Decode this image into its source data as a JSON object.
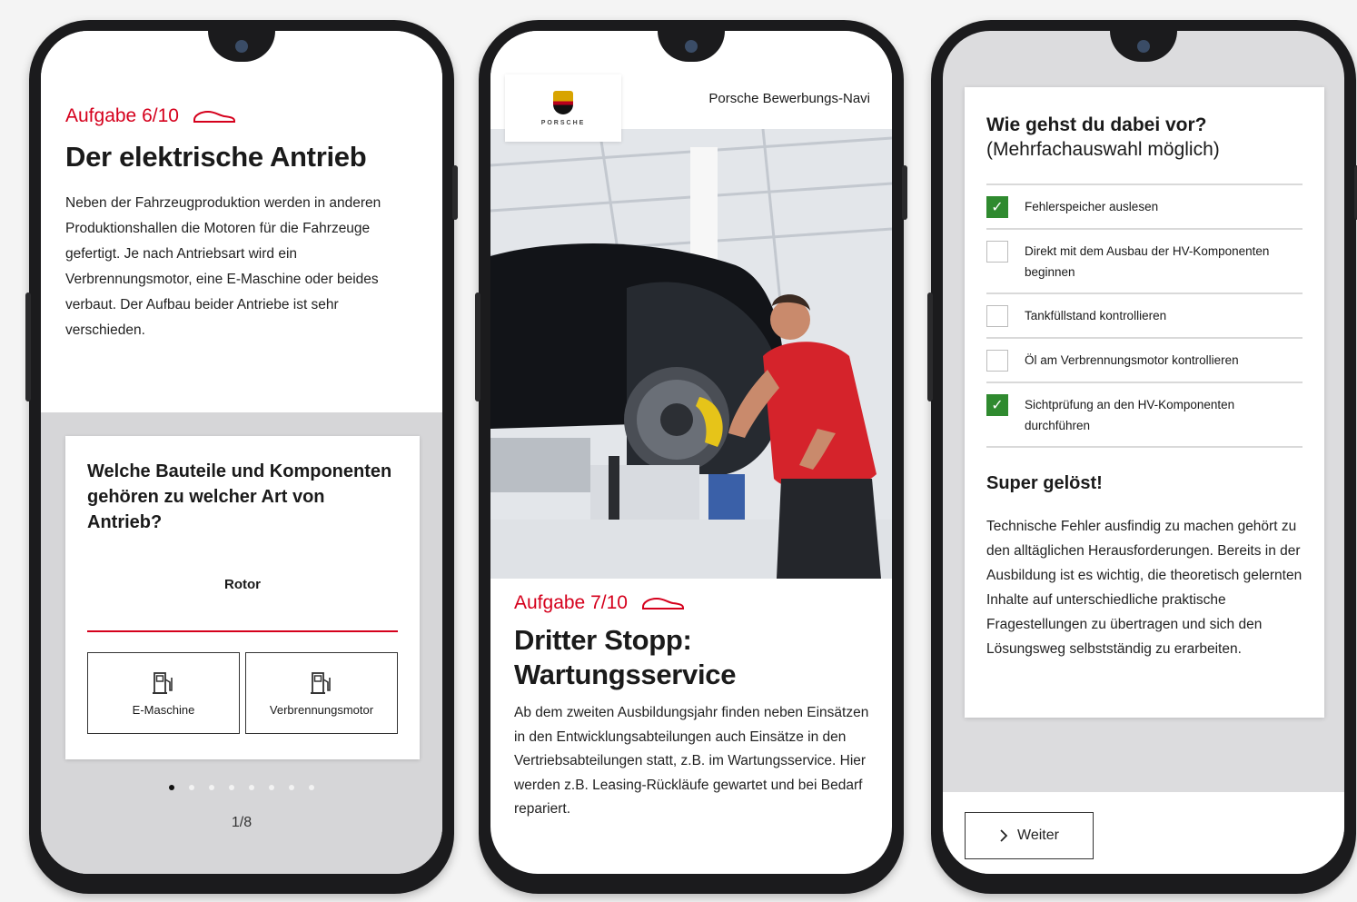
{
  "colors": {
    "accent": "#d5001c",
    "check_green": "#2f8a2f",
    "panel_grey": "#d6d6d8"
  },
  "phone1": {
    "task_label": "Aufgabe 6/10",
    "title": "Der elektrische Antrieb",
    "body": "Neben der Fahrzeugproduktion werden in anderen Produktionshallen die Motoren für die Fahrzeuge gefertigt. Je nach Antriebsart wird ein Verbrennungsmotor, eine E-Maschine oder beides verbaut. Der Aufbau beider Antriebe ist sehr verschieden.",
    "question": "Welche Bauteile und Komponenten gehören zu welcher Art von Antrieb?",
    "drag_item": "Rotor",
    "options": [
      {
        "label": "E-Maschine",
        "icon": "fuel-pump-icon"
      },
      {
        "label": "Verbrennungsmotor",
        "icon": "fuel-pump-icon"
      }
    ],
    "pager": "1/8"
  },
  "phone2": {
    "brand": "PORSCHE",
    "header_title": "Porsche Bewerbungs-Navi",
    "task_label": "Aufgabe 7/10",
    "title": "Dritter Stopp: Wartungsservice",
    "body": "Ab dem zweiten Ausbildungsjahr finden neben Einsätzen in den Entwicklungsabteilungen auch Einsätze in den Vertriebsabteilungen statt, z.B. im Wartungsservice. Hier werden z.B. Leasing-Rückläufe gewartet und bei Bedarf repariert."
  },
  "phone3": {
    "question_bold": "Wie gehst du dabei vor?",
    "question_sub": "(Mehrfachauswahl möglich)",
    "checklist": [
      {
        "label": "Fehlerspeicher auslesen",
        "checked": true
      },
      {
        "label": "Direkt mit dem Ausbau der HV-Komponenten beginnen",
        "checked": false
      },
      {
        "label": "Tankfüllstand kontrollieren",
        "checked": false
      },
      {
        "label": "Öl am Verbrennungsmotor kontrollieren",
        "checked": false
      },
      {
        "label": "Sichtprüfung an den HV-Komponenten durchführen",
        "checked": true
      }
    ],
    "result_title": "Super gelöst!",
    "result_text": "Technische Fehler ausfindig zu machen gehört zu den alltäglichen Herausforderungen. Bereits in der Ausbildung ist es wichtig, die theoretisch gelernten Inhalte auf unterschiedliche praktische Fragestellungen zu übertragen und sich den Lösungsweg selbstständig zu erarbeiten.",
    "next_button": "Weiter"
  }
}
